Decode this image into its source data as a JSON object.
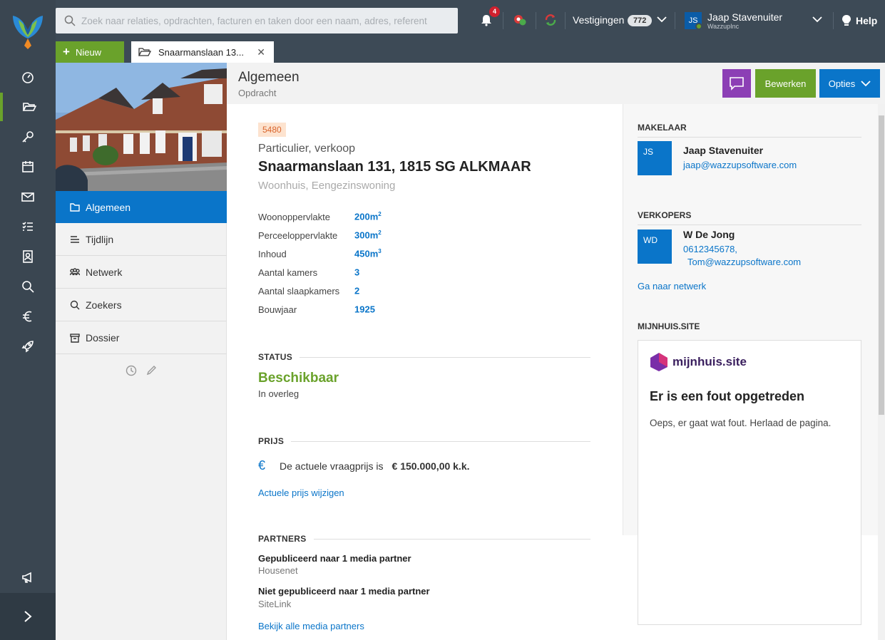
{
  "search": {
    "placeholder": "Zoek naar relaties, opdrachten, facturen en taken door een naam, adres, referent"
  },
  "topbar": {
    "notifications_count": "4",
    "vestigingen_label": "Vestigingen",
    "vestigingen_count": "772",
    "user_initials": "JS",
    "user_name": "Jaap Stavenuiter",
    "user_org": "WazzupInc",
    "help_label": "Help"
  },
  "tabs": {
    "new_label": "Nieuw",
    "open_tab_label": "Snaarmanslaan 13...",
    "close_glyph": "✕"
  },
  "header": {
    "title": "Algemeen",
    "subtitle": "Opdracht",
    "edit_label": "Bewerken",
    "options_label": "Opties"
  },
  "nav": {
    "items": [
      {
        "label": "Algemeen",
        "icon": "folder-icon"
      },
      {
        "label": "Tijdlijn",
        "icon": "timeline-icon"
      },
      {
        "label": "Netwerk",
        "icon": "network-icon"
      },
      {
        "label": "Zoekers",
        "icon": "search-icon"
      },
      {
        "label": "Dossier",
        "icon": "archive-icon"
      }
    ]
  },
  "property": {
    "reference": "5480",
    "type": "Particulier, verkoop",
    "address": "Snaarmanslaan 131, 1815 SG ALKMAAR",
    "kind": "Woonhuis, Eengezinswoning",
    "specs": [
      {
        "label": "Woonoppervlakte",
        "value": "200m",
        "sup": "2"
      },
      {
        "label": "Perceeloppervlakte",
        "value": "300m",
        "sup": "2"
      },
      {
        "label": "Inhoud",
        "value": "450m",
        "sup": "3"
      },
      {
        "label": "Aantal kamers",
        "value": "3",
        "sup": ""
      },
      {
        "label": "Aantal slaapkamers",
        "value": "2",
        "sup": ""
      },
      {
        "label": "Bouwjaar",
        "value": "1925",
        "sup": ""
      }
    ]
  },
  "status": {
    "heading": "STATUS",
    "value": "Beschikbaar",
    "sub": "In overleg"
  },
  "price": {
    "heading": "PRIJS",
    "currency_symbol": "€",
    "text": "De actuele vraagprijs is",
    "amount": "€ 150.000,00 k.k.",
    "change_link": "Actuele prijs wijzigen"
  },
  "partners": {
    "heading": "PARTNERS",
    "published_title": "Gepubliceerd naar 1 media partner",
    "published_partner": "Housenet",
    "unpublished_title": "Niet gepubliceerd naar 1 media partner",
    "unpublished_partner": "SiteLink",
    "all_link": "Bekijk alle media partners"
  },
  "makelaar": {
    "heading": "MAKELAAR",
    "initials": "JS",
    "name": "Jaap Stavenuiter",
    "email": "jaap@wazzupsoftware.com"
  },
  "verkopers": {
    "heading": "VERKOPERS",
    "initials": "WD",
    "name": "W De Jong",
    "phone": "0612345678,",
    "email": "Tom@wazzupsoftware.com",
    "network_link": "Ga naar netwerk"
  },
  "mijnhuis": {
    "heading": "MIJNHUIS.SITE",
    "logo_text": "mijnhuis.site",
    "error_title": "Er is een fout opgetreden",
    "error_message": "Oeps, er gaat wat fout. Herlaad de pagina."
  },
  "colors": {
    "green": "#6aa22b",
    "blue": "#0a75c9",
    "purple": "#8c3fb5",
    "dark": "#3d4a56"
  }
}
